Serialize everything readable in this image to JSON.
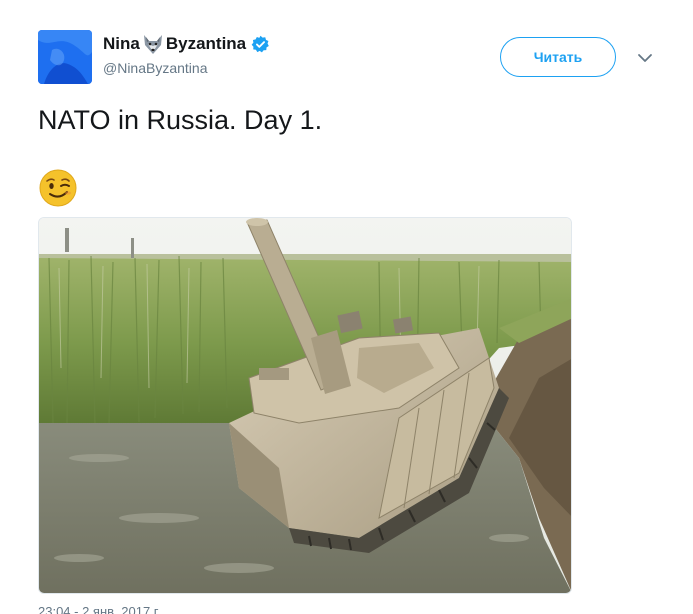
{
  "author": {
    "name_part1": "Nina",
    "name_part2": "Byzantina",
    "name_emoji_icon": "wolf-face-icon",
    "verified_icon": "verified-badge-icon",
    "handle": "@NinaByzantina",
    "avatar_color": "#1d6cf0"
  },
  "follow_button": {
    "label": "Читать",
    "color": "#1da1f2"
  },
  "menu_icon": "chevron-down-icon",
  "tweet": {
    "text": "NATO in Russia. Day 1.",
    "emoji_icon": "winking-face-icon"
  },
  "media": {
    "image_icon": "tank-in-ditch-photo"
  },
  "timestamp": "23:04 - 2 янв. 2017 г."
}
